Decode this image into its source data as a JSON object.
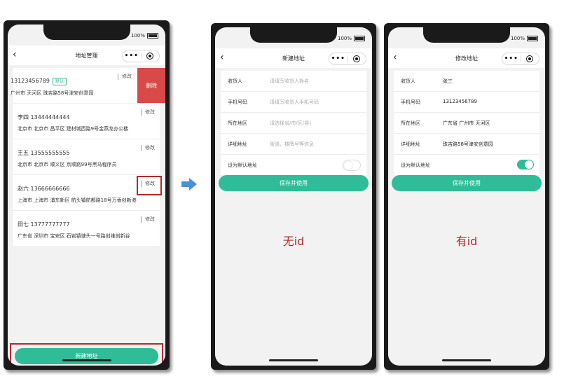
{
  "status": {
    "battery": "100%"
  },
  "screen1": {
    "title": "地址管理",
    "addresses": [
      {
        "name_phone": "13123456789",
        "default_tag": "默认",
        "address": "广州市 天河区 珠吉路58号津安创意园",
        "edit": "修改",
        "delete": "删除"
      },
      {
        "name_phone": "李四 13444444444",
        "address": "北京市 北京市 昌平区 建材城西路9号金燕龙办公楼",
        "edit": "修改"
      },
      {
        "name_phone": "王五 13555555555",
        "address": "北京市 北京市 顺义区 京顺路99号黑马程序员",
        "edit": "修改"
      },
      {
        "name_phone": "赵六 13666666666",
        "address": "上海市 上海市 浦东新区 航头镇航都路18号万香创新港",
        "edit": "修改"
      },
      {
        "name_phone": "田七 13777777777",
        "address": "广东省 深圳市 宝安区 石岩镇塘头一号路创维创新谷",
        "edit": "修改"
      }
    ],
    "new_button": "新建地址"
  },
  "screen2": {
    "title": "新建地址",
    "fields": [
      {
        "label": "收货人",
        "placeholder": "请填写收货人姓名"
      },
      {
        "label": "手机号码",
        "placeholder": "请填写收货人手机号码"
      },
      {
        "label": "所在地区",
        "placeholder": "请选择省/市/区(县)"
      },
      {
        "label": "详细地址",
        "placeholder": "街道、楼牌号等信息"
      }
    ],
    "default_label": "设为默认地址",
    "default_on": false,
    "save_button": "保存并使用",
    "caption": "无id"
  },
  "screen3": {
    "title": "修改地址",
    "fields": [
      {
        "label": "收货人",
        "value": "张三"
      },
      {
        "label": "手机号码",
        "value": "13123456789"
      },
      {
        "label": "所在地区",
        "value": "广东省 广州市 天河区"
      },
      {
        "label": "详细地址",
        "value": "珠吉路58号津安创意园"
      }
    ],
    "default_label": "设为默认地址",
    "default_on": true,
    "save_button": "保存并使用",
    "caption": "有id"
  },
  "colors": {
    "accent": "#2ebd98",
    "danger": "#d84a4a",
    "highlight": "#b02a2a",
    "arrow": "#4a90d9"
  }
}
